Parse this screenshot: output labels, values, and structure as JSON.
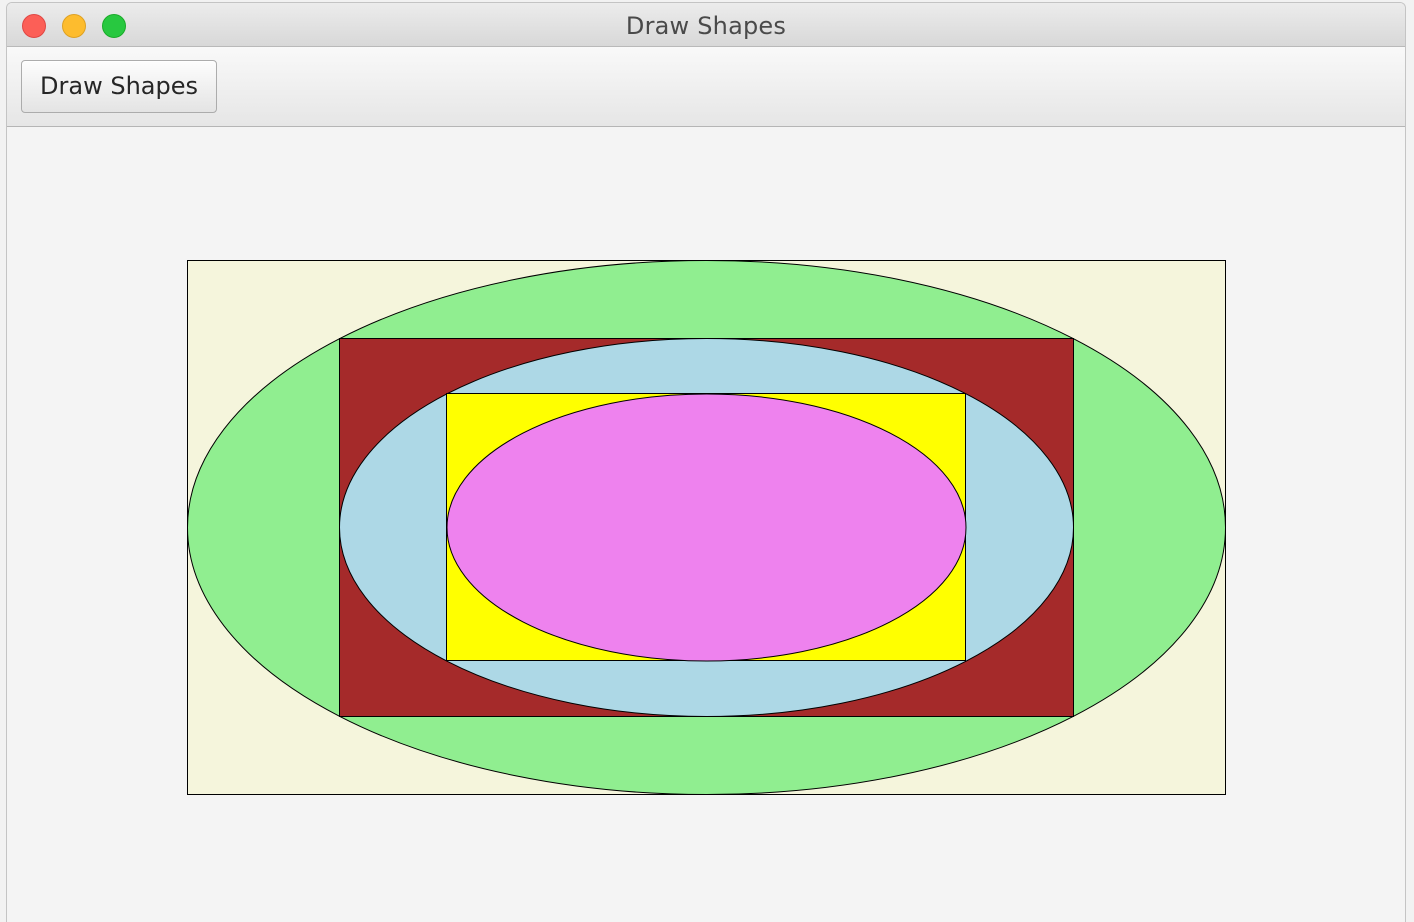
{
  "window": {
    "title": "Draw Shapes"
  },
  "toolbar": {
    "draw_button_label": "Draw Shapes"
  },
  "shapes": {
    "outer_rect_color": "#f5f5dc",
    "outer_ellipse_color": "#90ee90",
    "middle_rect_color": "#a52a2a",
    "middle_ellipse_color": "#add8e6",
    "inner_rect_color": "#ffff00",
    "inner_ellipse_color": "#ee82ee",
    "stroke_color": "#000000"
  }
}
